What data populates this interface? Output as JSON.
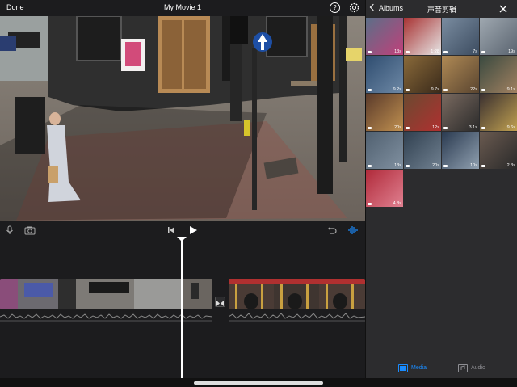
{
  "toolbar": {
    "done_label": "Done",
    "project_title": "My Movie 1",
    "help_label": "?"
  },
  "media_panel": {
    "back_label": "Albums",
    "album_title": "声音剪辑",
    "thumbnails": [
      {
        "duration": "13s"
      },
      {
        "duration": "1:28"
      },
      {
        "duration": "7s"
      },
      {
        "duration": "19s"
      },
      {
        "duration": "9.2s"
      },
      {
        "duration": "9.7s"
      },
      {
        "duration": "22s"
      },
      {
        "duration": "9.1s"
      },
      {
        "duration": "20s"
      },
      {
        "duration": "12s"
      },
      {
        "duration": "3.1s"
      },
      {
        "duration": "9.6s"
      },
      {
        "duration": "13s"
      },
      {
        "duration": "20s"
      },
      {
        "duration": "10s"
      },
      {
        "duration": "2.3s"
      },
      {
        "duration": "4.8s"
      }
    ],
    "tabs": [
      {
        "label": "Media",
        "active": true
      },
      {
        "label": "Audio",
        "active": false
      }
    ]
  },
  "colors": {
    "accent": "#1a8cff",
    "panel": "#2c2c2e",
    "background": "#1c1c1e"
  }
}
